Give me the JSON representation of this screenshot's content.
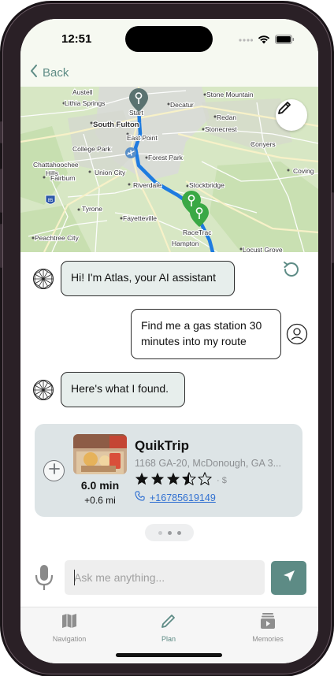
{
  "status_bar": {
    "time": "12:51"
  },
  "nav": {
    "back_label": "Back"
  },
  "map": {
    "labels": {
      "austell": "Austell",
      "lithia_springs": "Lithia Springs",
      "start": "Start",
      "decatur": "Decatur",
      "stone_mountain": "Stone Mountain",
      "south_fulton": "South Fulton",
      "redan": "Redan",
      "stonecrest": "Stonecrest",
      "east_point": "East Point",
      "college_park": "College Park",
      "forest_park": "Forest Park",
      "conyers": "Conyers",
      "chattahoochee_hills": "Chattahoochee",
      "hills": "Hills",
      "union_city": "Union City",
      "fairburn": "Fairburn",
      "riverdale": "Riverdale",
      "stockbridge": "Stockbridge",
      "covington": "Coving",
      "tyrone": "Tyrone",
      "fayetteville": "Fayetteville",
      "racetrac": "RaceTrac",
      "peachtree_city": "Peachtree City",
      "hampton": "Hampton",
      "locust_grove": "Locust Grove",
      "interstate": "85"
    }
  },
  "chat": {
    "messages": [
      {
        "role": "assistant",
        "text": "Hi! I'm Atlas, your AI assistant"
      },
      {
        "role": "user",
        "text": "Find me a gas station 30 minutes into my route"
      },
      {
        "role": "assistant",
        "text": "Here's what I found."
      }
    ]
  },
  "result": {
    "name": "QuikTrip",
    "address": "1168 GA-20, McDonough, GA 3...",
    "rating": 3.5,
    "rating_max": 5,
    "price": "· $",
    "phone": "+16785619149",
    "eta": "6.0 min",
    "detour": "+0.6 mi"
  },
  "pager": {
    "count": 3,
    "active": 0
  },
  "composer": {
    "placeholder": "Ask me anything..."
  },
  "tabs": [
    {
      "label": "Navigation",
      "icon": "map-icon"
    },
    {
      "label": "Plan",
      "icon": "pencil-icon"
    },
    {
      "label": "Memories",
      "icon": "memories-icon"
    }
  ],
  "active_tab": "Plan",
  "colors": {
    "accent": "#5d8b85",
    "route": "#1e7be0",
    "pin_start": "#5a7270",
    "pin_stop": "#3aa845",
    "ai_bubble": "#e7eeec",
    "card_bg": "#dde4e6",
    "link": "#2f6fd1"
  }
}
